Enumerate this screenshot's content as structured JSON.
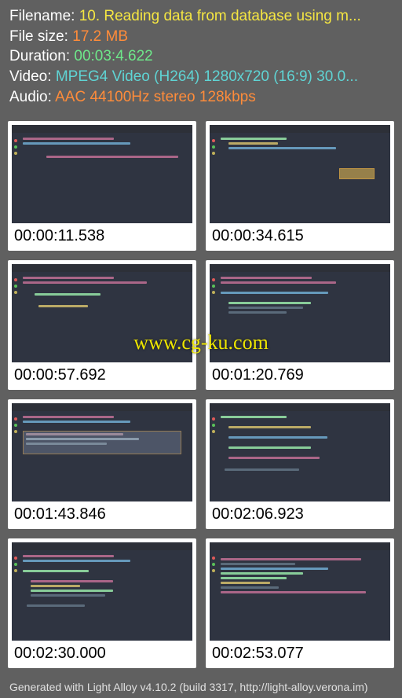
{
  "info": {
    "filename_label": "Filename: ",
    "filename_value": "10. Reading data from database using m...",
    "filesize_label": "File size: ",
    "filesize_value": "17.2 MB",
    "duration_label": "Duration: ",
    "duration_value": "00:03:4.622",
    "video_label": "Video: ",
    "video_value": "MPEG4 Video (H264) 1280x720 (16:9) 30.0...",
    "audio_label": "Audio: ",
    "audio_value": "AAC 44100Hz stereo 128kbps"
  },
  "thumbnails": [
    {
      "timecode": "00:00:11.538"
    },
    {
      "timecode": "00:00:34.615"
    },
    {
      "timecode": "00:00:57.692"
    },
    {
      "timecode": "00:01:20.769"
    },
    {
      "timecode": "00:01:43.846"
    },
    {
      "timecode": "00:02:06.923"
    },
    {
      "timecode": "00:02:30.000"
    },
    {
      "timecode": "00:02:53.077"
    }
  ],
  "watermark": "www.cg-ku.com",
  "footer": "Generated with Light Alloy v4.10.2 (build 3317, http://light-alloy.verona.im)"
}
